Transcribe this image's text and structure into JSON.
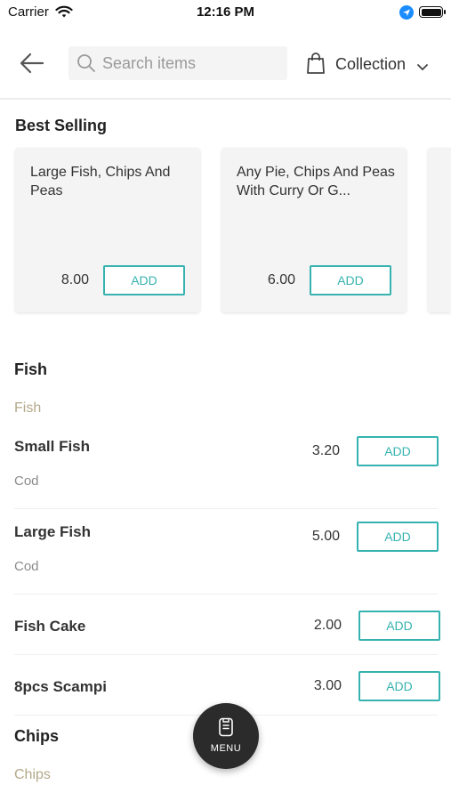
{
  "status_bar": {
    "carrier": "Carrier",
    "time": "12:16 PM"
  },
  "header": {
    "search_placeholder": "Search items",
    "collection_label": "Collection",
    "icons": [
      "back-arrow-icon",
      "search-icon",
      "shopping-bag-icon",
      "chevron-down-icon"
    ]
  },
  "best_selling": {
    "title": "Best Selling",
    "cards": [
      {
        "name": "Large Fish, Chips And Peas",
        "price": "8.00",
        "add_label": "ADD"
      },
      {
        "name": "Any Pie, Chips And Peas With Curry Or G...",
        "price": "6.00",
        "add_label": "ADD"
      }
    ]
  },
  "categories": [
    {
      "title": "Fish",
      "subtitle": "Fish",
      "items": [
        {
          "name": "Small Fish",
          "description": "Cod",
          "price": "3.20",
          "add_label": "ADD"
        },
        {
          "name": "Large Fish",
          "description": "Cod",
          "price": "5.00",
          "add_label": "ADD"
        },
        {
          "name": "Fish Cake",
          "description": "",
          "price": "2.00",
          "add_label": "ADD"
        },
        {
          "name": "8pcs Scampi",
          "description": "",
          "price": "3.00",
          "add_label": "ADD"
        }
      ]
    },
    {
      "title": "Chips",
      "subtitle": "Chips",
      "items": []
    }
  ],
  "menu_button": {
    "label": "MENU"
  },
  "colors": {
    "accent": "#36b3b0",
    "subtitle": "#b3a98a",
    "fab": "#2b2b2b"
  }
}
